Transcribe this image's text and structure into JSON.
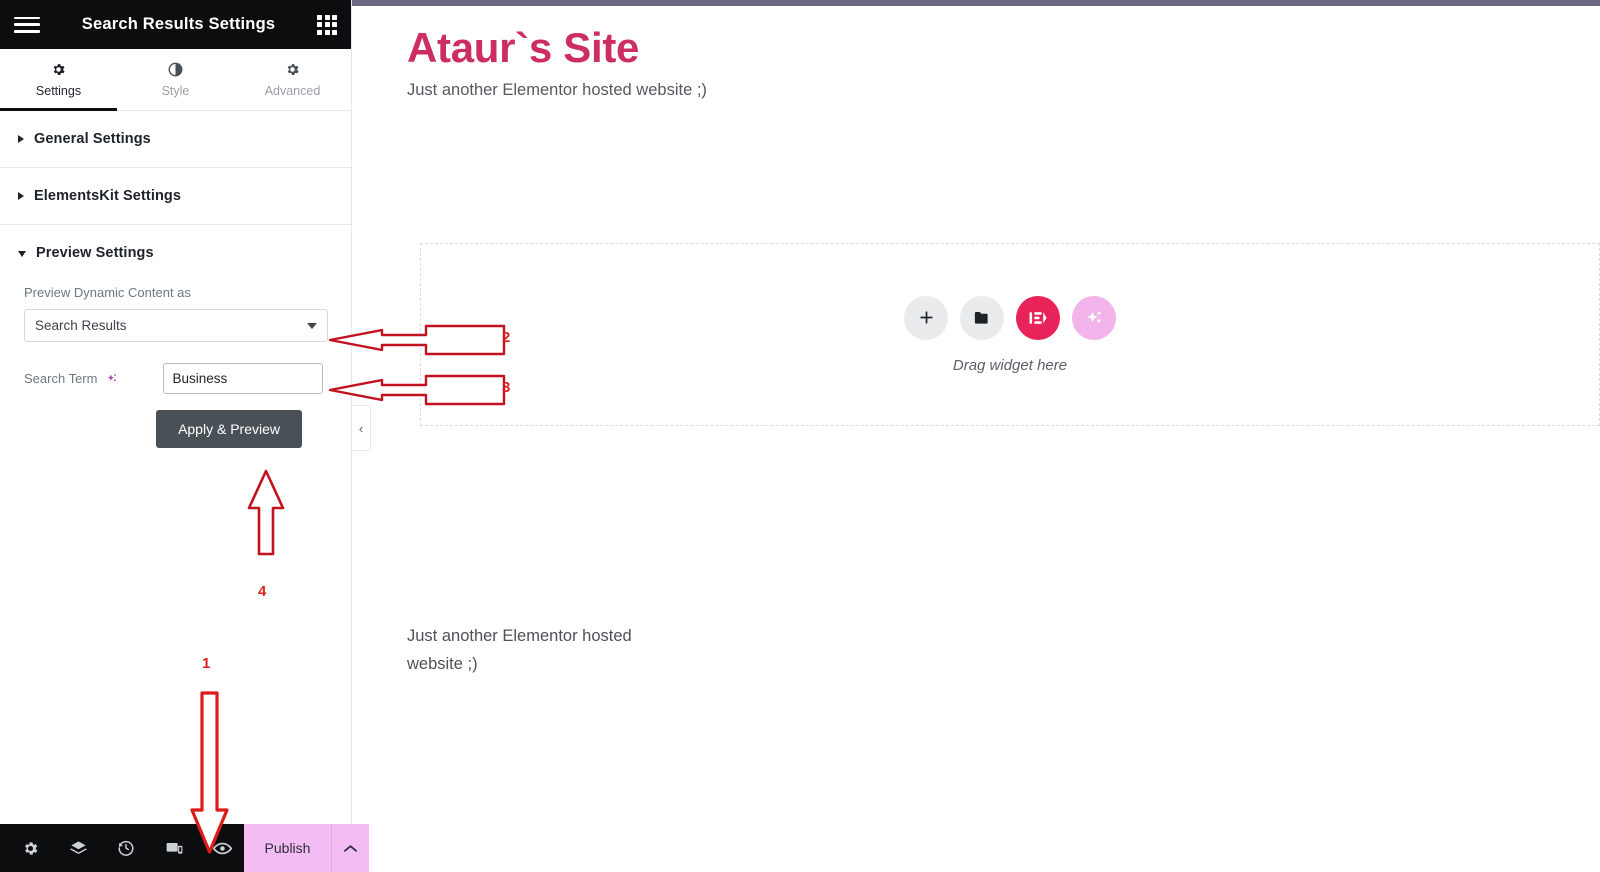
{
  "panel": {
    "header": {
      "title": "Search Results Settings",
      "menu_icon": "hamburger-icon",
      "apps_icon": "grid-apps-icon"
    },
    "tabs": [
      {
        "label": "Settings",
        "icon": "gear-icon",
        "active": true
      },
      {
        "label": "Style",
        "icon": "contrast-icon",
        "active": false
      },
      {
        "label": "Advanced",
        "icon": "gear-icon",
        "active": false
      }
    ],
    "sections": [
      {
        "title": "General Settings",
        "expanded": false
      },
      {
        "title": "ElementsKit Settings",
        "expanded": false
      },
      {
        "title": "Preview Settings",
        "expanded": true
      }
    ],
    "preview_settings": {
      "dynamic_content_label": "Preview Dynamic Content as",
      "dynamic_content_value": "Search Results",
      "dynamic_content_options": [
        "Search Results"
      ],
      "search_term_label": "Search Term",
      "search_term_value": "Business",
      "search_term_placeholder": "",
      "apply_button": "Apply & Preview"
    },
    "collapse_handle": "‹",
    "footer": {
      "tools": [
        {
          "name": "settings-gear-icon",
          "label": "Settings"
        },
        {
          "name": "navigator-layers-icon",
          "label": "Navigator"
        },
        {
          "name": "history-clock-icon",
          "label": "History"
        },
        {
          "name": "responsive-devices-icon",
          "label": "Responsive Mode"
        },
        {
          "name": "preview-eye-icon",
          "label": "Preview Changes"
        }
      ],
      "publish_label": "Publish",
      "publish_caret": "⌃"
    }
  },
  "canvas": {
    "site_title": "Ataur`s Site",
    "site_tagline": "Just another Elementor hosted website ;)",
    "drop_area": {
      "drag_label": "Drag widget here",
      "buttons": [
        {
          "name": "add-element-button",
          "icon": "plus-icon"
        },
        {
          "name": "add-template-button",
          "icon": "folder-icon"
        },
        {
          "name": "elementskit-button",
          "icon": "elementskit-logo-icon"
        },
        {
          "name": "ai-button",
          "icon": "ai-sparkle-icon"
        }
      ]
    },
    "body_text": "Just another Elementor hosted website ;)"
  },
  "annotations": [
    {
      "number": "1",
      "target": "preview-eye-icon",
      "direction": "down"
    },
    {
      "number": "2",
      "target": "dynamic-content-select",
      "direction": "left"
    },
    {
      "number": "3",
      "target": "search-term-input",
      "direction": "left"
    },
    {
      "number": "4",
      "target": "apply-preview-button",
      "direction": "up"
    }
  ],
  "colors": {
    "panel_header_bg": "#0c0d0e",
    "site_title": "#cc2e62",
    "elementskit_red": "#e8235a",
    "ai_pink": "#f2b4ea",
    "publish_bg": "#f3bdf3",
    "apply_btn": "#495157",
    "annotation_red": "#e02020",
    "canvas_topbar": "#6d6880"
  }
}
